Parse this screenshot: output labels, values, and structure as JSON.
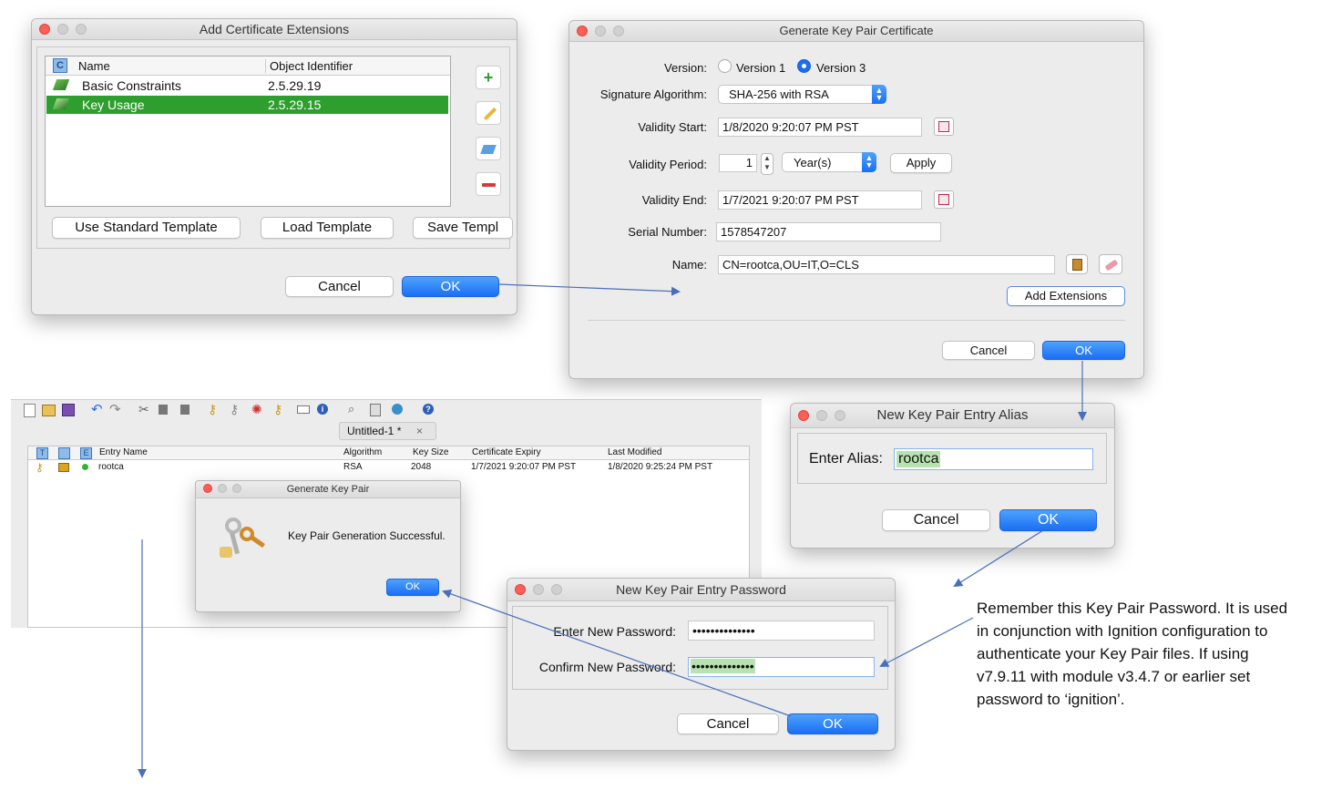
{
  "add_ext": {
    "title": "Add Certificate Extensions",
    "col_c": "C",
    "col_name": "Name",
    "col_oid": "Object Identifier",
    "rows": [
      {
        "name": "Basic Constraints",
        "oid": "2.5.29.19"
      },
      {
        "name": "Key Usage",
        "oid": "2.5.29.15"
      }
    ],
    "use_template": "Use Standard Template",
    "load_template": "Load Template",
    "save_template": "Save Templ",
    "cancel": "Cancel",
    "ok": "OK"
  },
  "gen_cert": {
    "title": "Generate Key Pair Certificate",
    "version_label": "Version:",
    "version1": "Version 1",
    "version3": "Version 3",
    "sigalg_label": "Signature Algorithm:",
    "sigalg_value": "SHA-256 with RSA",
    "vstart_label": "Validity Start:",
    "vstart_value": "1/8/2020 9:20:07 PM PST",
    "vperiod_label": "Validity Period:",
    "vperiod_value": "1",
    "vperiod_unit": "Year(s)",
    "apply": "Apply",
    "vend_label": "Validity End:",
    "vend_value": "1/7/2021 9:20:07 PM PST",
    "serial_label": "Serial Number:",
    "serial_value": "1578547207",
    "name_label": "Name:",
    "name_value": "CN=rootca,OU=IT,O=CLS",
    "add_ext": "Add Extensions",
    "cancel": "Cancel",
    "ok": "OK"
  },
  "keystore": {
    "tab": "Untitled-1 *",
    "tab_close": "×",
    "col_t": "T",
    "col_e": "E",
    "cols": [
      "Entry Name",
      "Algorithm",
      "Key Size",
      "Certificate Expiry",
      "Last Modified"
    ],
    "row": {
      "name": "rootca",
      "alg": "RSA",
      "size": "2048",
      "expiry": "1/7/2021 9:20:07 PM PST",
      "modified": "1/8/2020 9:25:24 PM PST"
    }
  },
  "gen_kp": {
    "title": "Generate Key Pair",
    "message": "Key Pair Generation Successful.",
    "ok": "OK"
  },
  "alias": {
    "title": "New Key Pair Entry Alias",
    "label": "Enter Alias:",
    "value": "rootca",
    "cancel": "Cancel",
    "ok": "OK"
  },
  "password": {
    "title": "New Key Pair Entry Password",
    "enter_label": "Enter New Password:",
    "enter_value": "••••••••••••••",
    "confirm_label": "Confirm New Password:",
    "confirm_value": "••••••••••••••",
    "cancel": "Cancel",
    "ok": "OK"
  },
  "note": {
    "lines": [
      "Remember this Key Pair Password.  It is used",
      "in conjunction with Ignition configuration to",
      "authenticate your Key Pair files.  If using",
      "v7.9.11 with module v3.4.7 or earlier set",
      "password to ‘ignition’."
    ]
  },
  "colors": {
    "accent_blue": "#1a6ef5",
    "selection_green": "#2e9e2e",
    "alias_highlight": "#b7e3b0",
    "arrow": "#4a6fb8"
  }
}
